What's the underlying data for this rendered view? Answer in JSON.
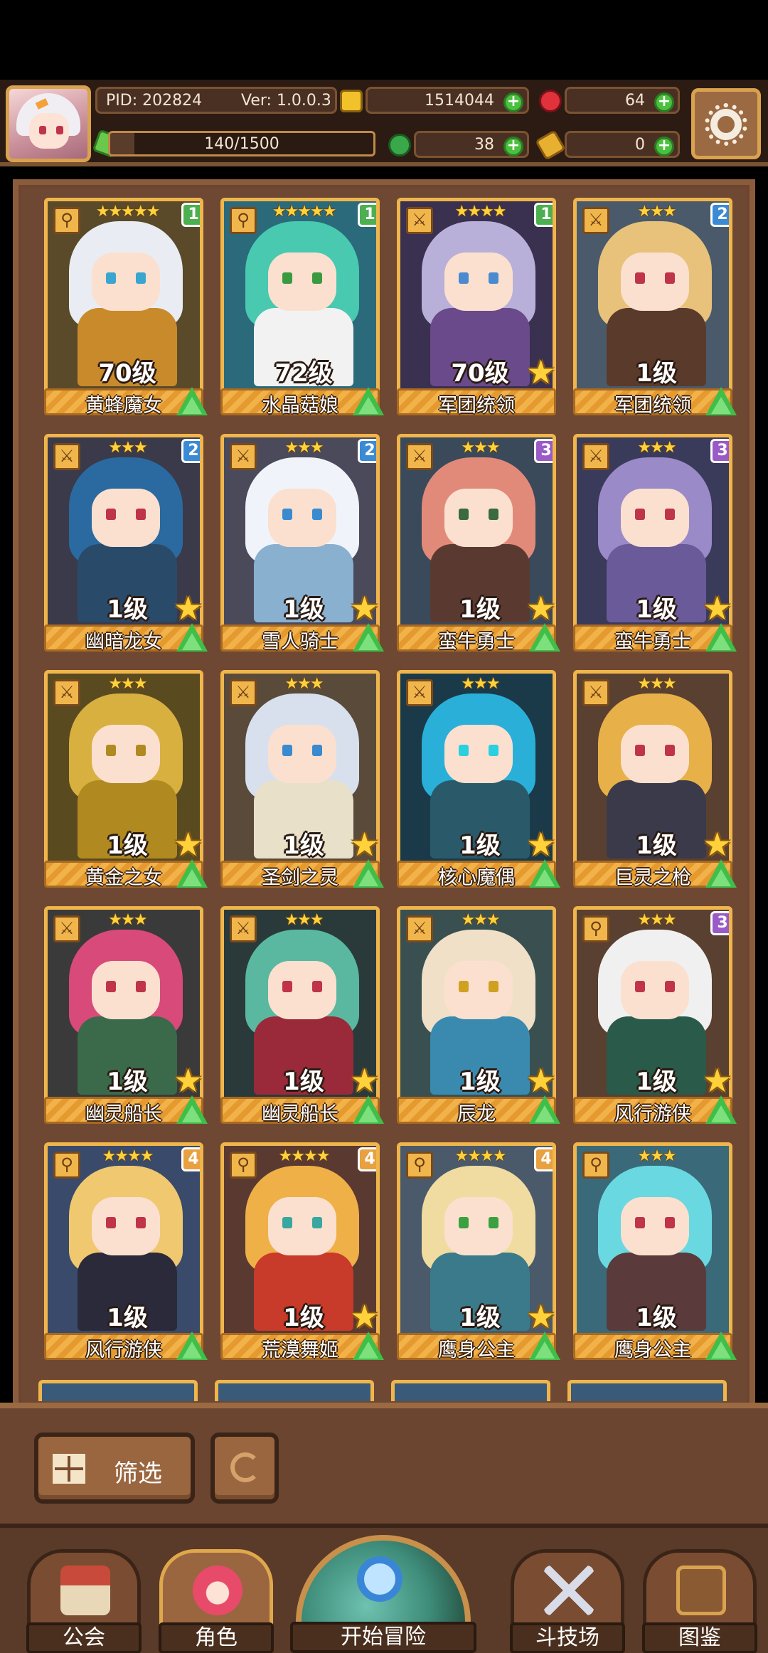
{
  "player": {
    "pid": "PID: 202824",
    "version": "Ver: 1.0.0.3",
    "stamina": "140/1500",
    "stamina_fraction": 0.093
  },
  "currency": {
    "gold": "1514044",
    "gems": "64",
    "clover": "38",
    "key": "0"
  },
  "icons": {
    "gold": "gold-coin-icon",
    "gems": "red-gem-icon",
    "clover": "clover-icon",
    "key": "key-icon",
    "stamina": "stamina-gem-icon",
    "settings": "gear-icon"
  },
  "cards": [
    {
      "name": "黄蜂魔女",
      "level": "70级",
      "stars": "★★★★★",
      "rank": "1",
      "rank_color": "#4caf50",
      "weapon": "⚲",
      "star_badge": false,
      "up_badge": true,
      "hair": "#e9edf3",
      "body": "#c88a2a",
      "bg": "#5a4a2a",
      "eye": "#3aa6d0"
    },
    {
      "name": "水晶菇娘",
      "level": "72级",
      "stars": "★★★★★",
      "rank": "1",
      "rank_color": "#4caf50",
      "weapon": "⚲",
      "star_badge": false,
      "up_badge": true,
      "hair": "#48c9b0",
      "body": "#f2f2f2",
      "bg": "#2a6a7a",
      "eye": "#3a9a40"
    },
    {
      "name": "军团统领",
      "level": "70级",
      "stars": "★★★★",
      "rank": "1",
      "rank_color": "#4caf50",
      "weapon": "⚔",
      "star_badge": true,
      "up_badge": false,
      "hair": "#b8b0d8",
      "body": "#6a4a8a",
      "bg": "#3a3050",
      "eye": "#4a8ad0"
    },
    {
      "name": "军团统领",
      "level": "1级",
      "stars": "★★★",
      "rank": "2",
      "rank_color": "#3a8ad6",
      "weapon": "⚔",
      "star_badge": false,
      "up_badge": true,
      "hair": "#e8c27a",
      "body": "#5a3a2a",
      "bg": "#4a5a6a",
      "eye": "#c0344a"
    },
    {
      "name": "幽暗龙女",
      "level": "1级",
      "stars": "★★★",
      "rank": "2",
      "rank_color": "#3a8ad6",
      "weapon": "⚔",
      "star_badge": true,
      "up_badge": true,
      "hair": "#2a6aa0",
      "body": "#2a4a6a",
      "bg": "#3a3a4a",
      "eye": "#c0344a"
    },
    {
      "name": "雪人骑士",
      "level": "1级",
      "stars": "★★★",
      "rank": "2",
      "rank_color": "#3a8ad6",
      "weapon": "⚔",
      "star_badge": true,
      "up_badge": true,
      "hair": "#f0f4fa",
      "body": "#8ab0d0",
      "bg": "#4a4a5a",
      "eye": "#3a8ad0"
    },
    {
      "name": "蛮牛勇士",
      "level": "1级",
      "stars": "★★★",
      "rank": "3",
      "rank_color": "#9a5ac8",
      "weapon": "⚔",
      "star_badge": true,
      "up_badge": true,
      "hair": "#e28a7a",
      "body": "#5a3a30",
      "bg": "#3a4a5a",
      "eye": "#3a6a40"
    },
    {
      "name": "蛮牛勇士",
      "level": "1级",
      "stars": "★★★",
      "rank": "3",
      "rank_color": "#9a5ac8",
      "weapon": "⚔",
      "star_badge": true,
      "up_badge": true,
      "hair": "#9a8ac8",
      "body": "#6a5a9a",
      "bg": "#3a3a5a",
      "eye": "#c0344a"
    },
    {
      "name": "黄金之女",
      "level": "1级",
      "stars": "★★★",
      "rank": "",
      "rank_color": "",
      "weapon": "⚔",
      "star_badge": true,
      "up_badge": true,
      "hair": "#d8b040",
      "body": "#b08a20",
      "bg": "#5a4a20",
      "eye": "#b08a20"
    },
    {
      "name": "圣剑之灵",
      "level": "1级",
      "stars": "★★★",
      "rank": "",
      "rank_color": "",
      "weapon": "⚔",
      "star_badge": true,
      "up_badge": true,
      "hair": "#d8e0ee",
      "body": "#e8e0c8",
      "bg": "#5a4a3a",
      "eye": "#3a8ad0"
    },
    {
      "name": "核心魔偶",
      "level": "1级",
      "stars": "★★★",
      "rank": "",
      "rank_color": "",
      "weapon": "⚔",
      "star_badge": true,
      "up_badge": true,
      "hair": "#2ab0d8",
      "body": "#2a5a6a",
      "bg": "#1a3a4a",
      "eye": "#2ad0e0"
    },
    {
      "name": "巨灵之枪",
      "level": "1级",
      "stars": "★★★",
      "rank": "",
      "rank_color": "",
      "weapon": "⚔",
      "star_badge": true,
      "up_badge": true,
      "hair": "#e8b048",
      "body": "#3a3a4a",
      "bg": "#5a4030",
      "eye": "#c0344a"
    },
    {
      "name": "幽灵船长",
      "level": "1级",
      "stars": "★★★",
      "rank": "",
      "rank_color": "",
      "weapon": "⚔",
      "star_badge": true,
      "up_badge": true,
      "hair": "#d84a7a",
      "body": "#3a6a4a",
      "bg": "#3a3a3a",
      "eye": "#c0344a"
    },
    {
      "name": "幽灵船长",
      "level": "1级",
      "stars": "★★★",
      "rank": "",
      "rank_color": "",
      "weapon": "⚔",
      "star_badge": true,
      "up_badge": true,
      "hair": "#5ab8a0",
      "body": "#9a2a3a",
      "bg": "#2a3a3a",
      "eye": "#c0344a"
    },
    {
      "name": "辰龙",
      "level": "1级",
      "stars": "★★★",
      "rank": "",
      "rank_color": "",
      "weapon": "⚔",
      "star_badge": true,
      "up_badge": true,
      "hair": "#f0e0c8",
      "body": "#3a8ab0",
      "bg": "#3a5050",
      "eye": "#d0a020"
    },
    {
      "name": "风行游侠",
      "level": "1级",
      "stars": "★★★",
      "rank": "3",
      "rank_color": "#9a5ac8",
      "weapon": "⚲",
      "star_badge": true,
      "up_badge": true,
      "hair": "#f0f0f0",
      "body": "#2a5a4a",
      "bg": "#5a4030",
      "eye": "#c0344a"
    },
    {
      "name": "风行游侠",
      "level": "1级",
      "stars": "★★★★",
      "rank": "4",
      "rank_color": "#e8a040",
      "weapon": "⚲",
      "star_badge": false,
      "up_badge": true,
      "hair": "#f0c870",
      "body": "#2a2a3a",
      "bg": "#3a4a6a",
      "eye": "#c0344a"
    },
    {
      "name": "荒漠舞姬",
      "level": "1级",
      "stars": "★★★★",
      "rank": "4",
      "rank_color": "#e8a040",
      "weapon": "⚲",
      "star_badge": true,
      "up_badge": true,
      "hair": "#f0b048",
      "body": "#c83a2a",
      "bg": "#5a3a30",
      "eye": "#3aa6a0"
    },
    {
      "name": "鹰身公主",
      "level": "1级",
      "stars": "★★★★",
      "rank": "4",
      "rank_color": "#e8a040",
      "weapon": "⚲",
      "star_badge": true,
      "up_badge": true,
      "hair": "#f0dca0",
      "body": "#3a7a8a",
      "bg": "#4a5a6a",
      "eye": "#3aa040"
    },
    {
      "name": "鹰身公主",
      "level": "1级",
      "stars": "★★★",
      "rank": "",
      "rank_color": "",
      "weapon": "⚲",
      "star_badge": false,
      "up_badge": true,
      "hair": "#6ad8e0",
      "body": "#5a3a3a",
      "bg": "#3a6a7a",
      "eye": "#c0344a"
    }
  ],
  "filter": {
    "label": "筛选",
    "icon": "grid-icon",
    "reset_icon": "refresh-icon"
  },
  "nav": {
    "guild": "公会",
    "character": "角色",
    "adventure": "开始冒险",
    "arena": "斗技场",
    "codex": "图鉴"
  }
}
